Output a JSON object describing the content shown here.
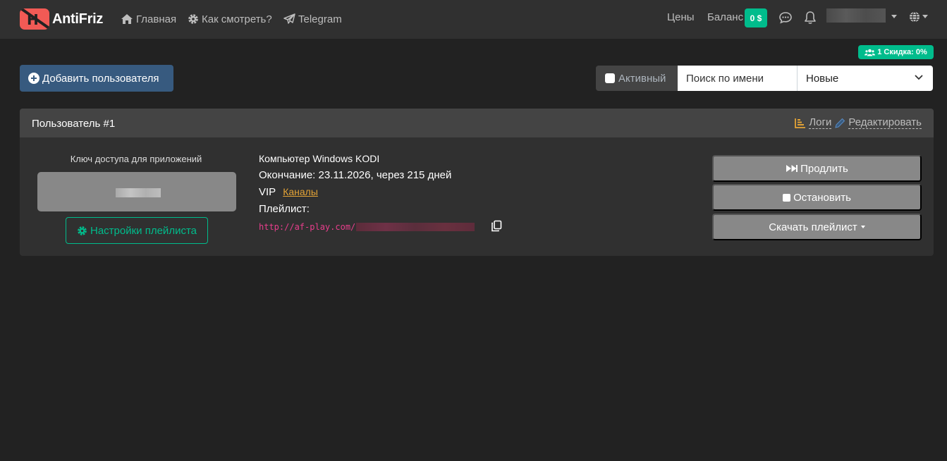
{
  "navbar": {
    "brand": "AntiFriz",
    "logo_letter": "H",
    "links": [
      {
        "label": "Главная",
        "icon": "home-icon"
      },
      {
        "label": "Как смотреть?",
        "icon": "gear-icon"
      },
      {
        "label": "Telegram",
        "icon": "paper-plane-icon"
      }
    ],
    "prices_label": "Цены",
    "balance_label": "Баланс",
    "balance_value": "0 $",
    "icons": [
      "chat-icon",
      "bell-icon",
      "globe-icon"
    ]
  },
  "discount_badge": "1 Скидка: 0%",
  "toolbar": {
    "add_user_label": "Добавить пользователя",
    "active_label": "Активный",
    "search_placeholder": "Поиск по имени",
    "sort_value": "Новые"
  },
  "user_card": {
    "title": "Пользователь #1",
    "logs_label": "Логи",
    "edit_label": "Редактировать",
    "access_key_label": "Ключ доступа для приложений",
    "playlist_settings_label": "Настройки плейлиста",
    "device": "Компьютер Windows KODI",
    "expiry": "Окончание: 23.11.2026, через 215 дней",
    "tier": "VIP",
    "channels_label": "Каналы",
    "playlist_label": "Плейлист:",
    "playlist_url": "http://af-play.com/",
    "extend_label": "Продлить",
    "stop_label": "Остановить",
    "download_label": "Скачать плейлист"
  },
  "colors": {
    "background": "#222222",
    "navbar": "#303030",
    "accent_green": "#00bc8c",
    "primary_blue": "#375a7f",
    "logo_red": "#f25a55",
    "link_orange": "#e3a336",
    "url_pink": "#e83e8c"
  }
}
